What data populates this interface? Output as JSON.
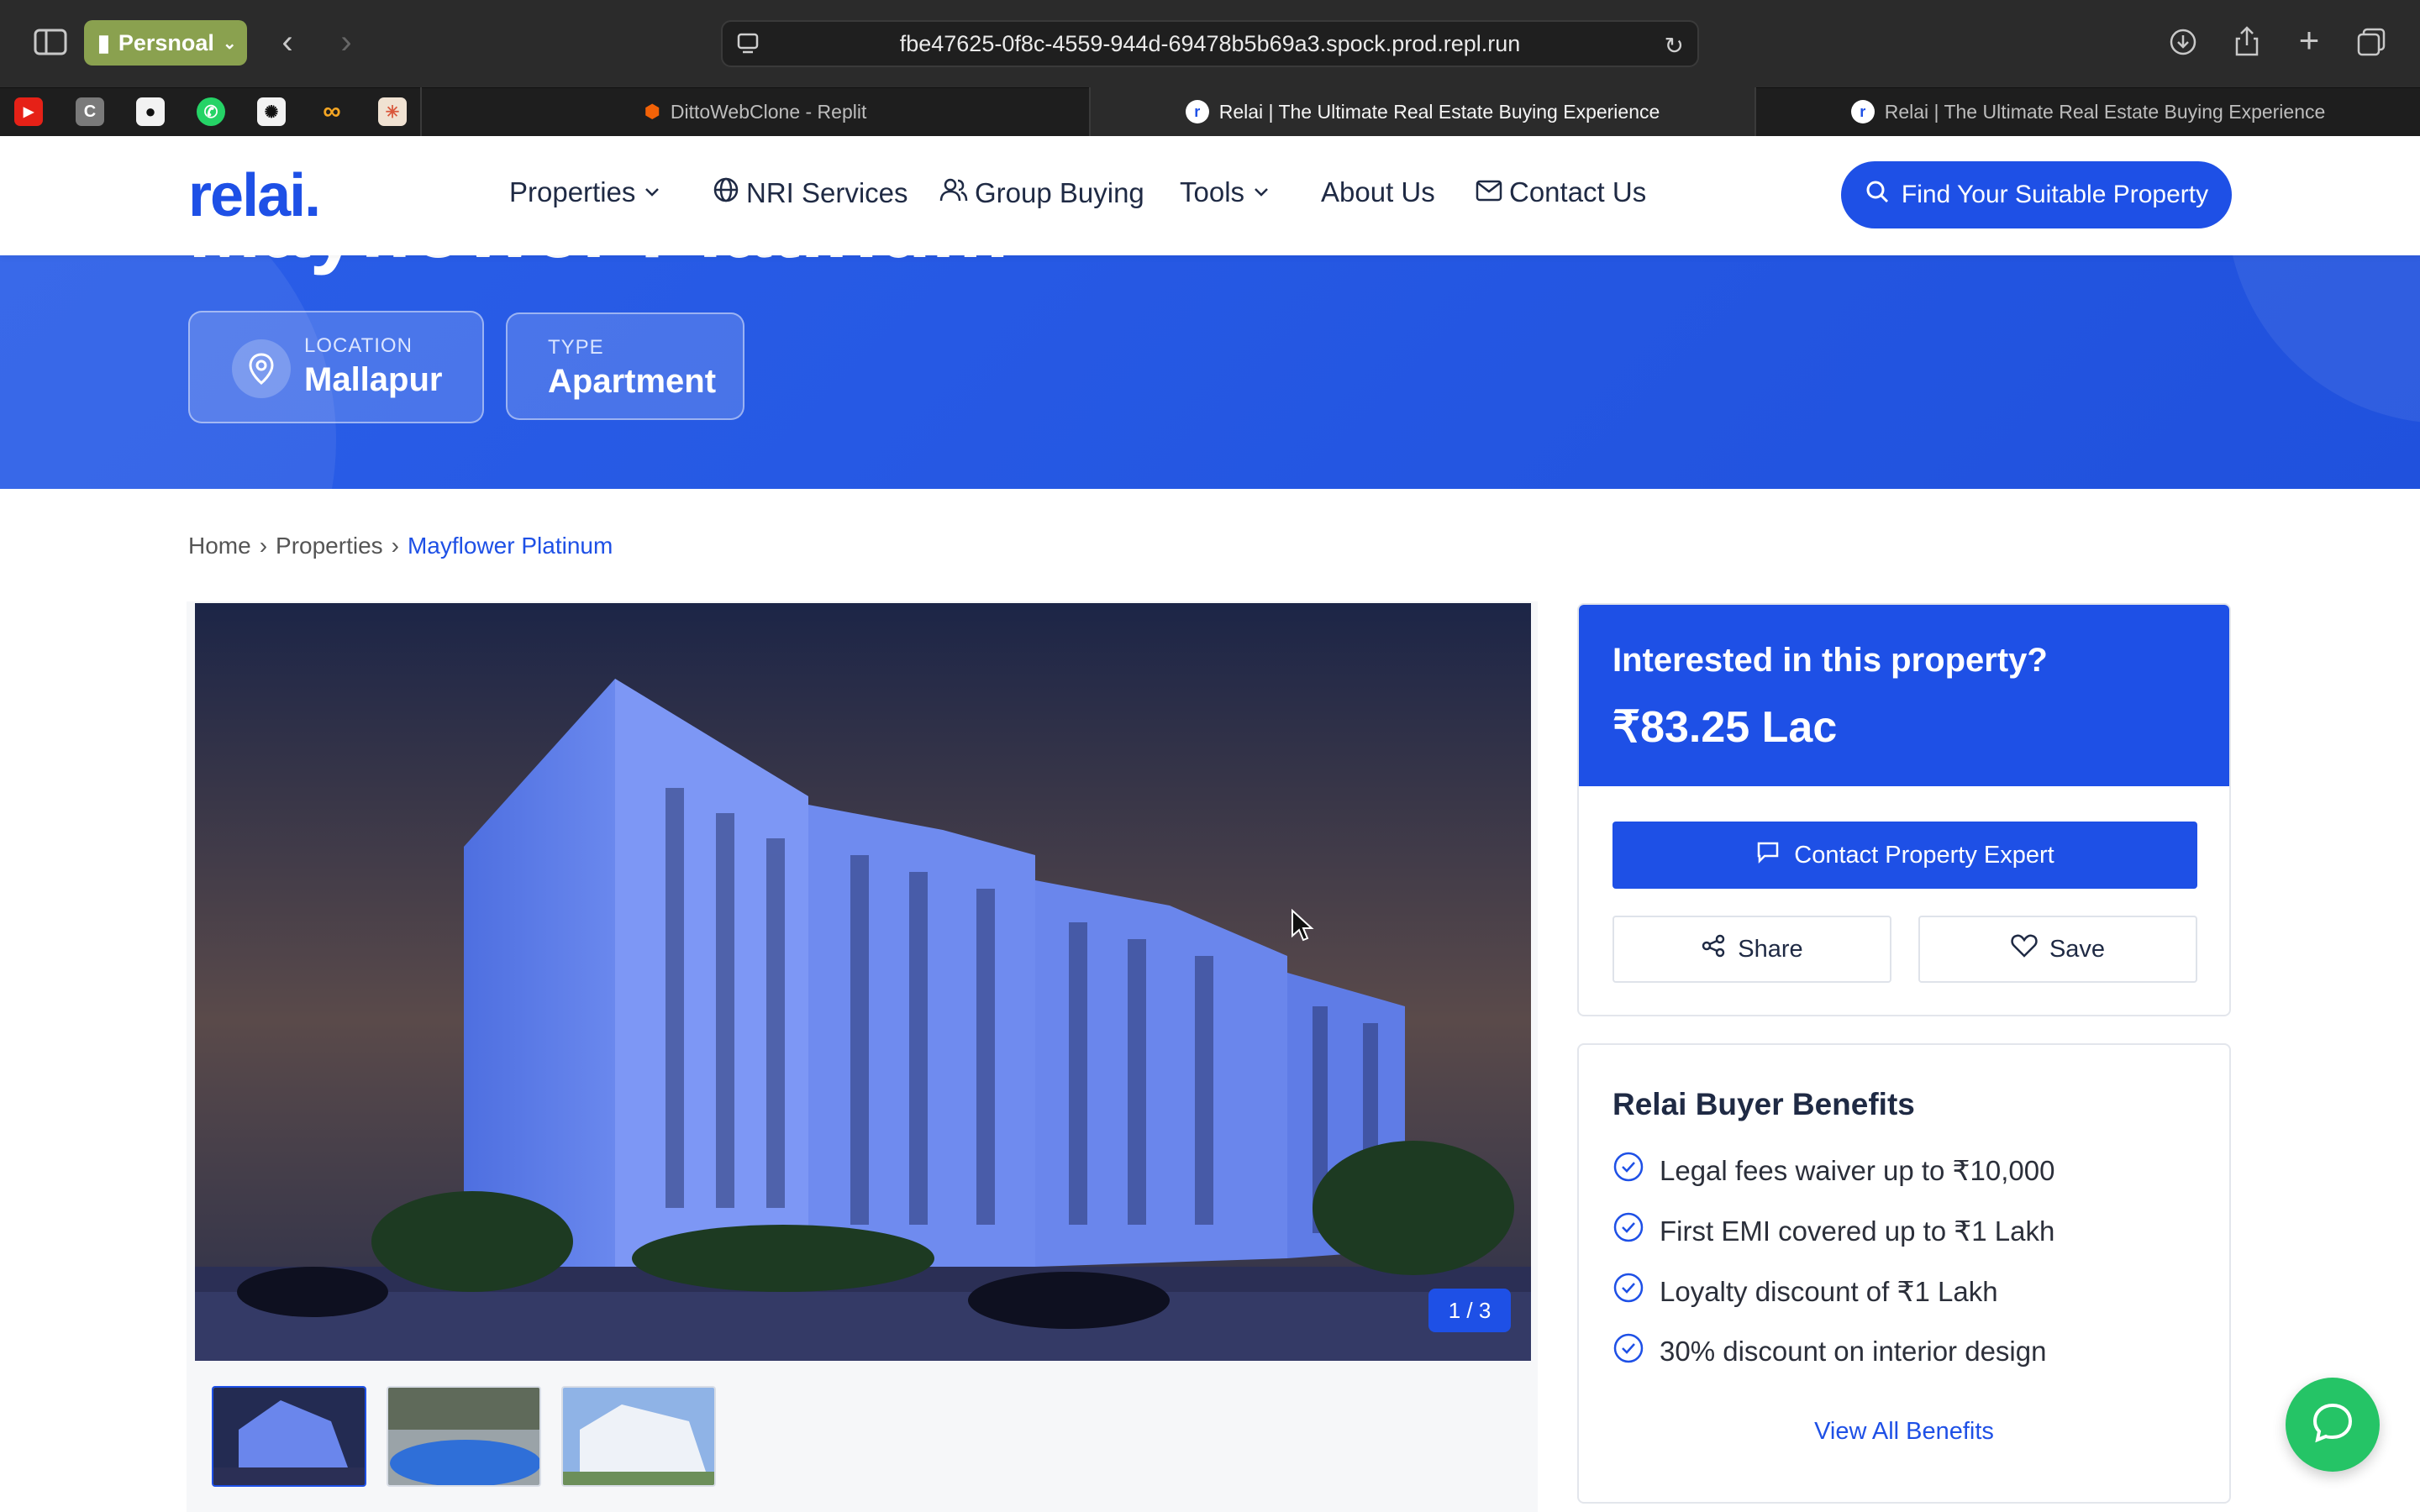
{
  "browser": {
    "profile_label": "Persnoal",
    "url": "fbe47625-0f8c-4559-944d-69478b5b69a3.spock.prod.repl.run",
    "favorites": [
      "youtube-icon",
      "c-icon",
      "github-icon",
      "whatsapp-icon",
      "openai-icon",
      "infinity-icon",
      "asterisk-icon"
    ],
    "tabs": [
      {
        "title": "DittoWebClone - Replit",
        "active": false
      },
      {
        "title": "Relai | The Ultimate Real Estate Buying Experience",
        "active": true
      },
      {
        "title": "Relai | The Ultimate Real Estate Buying Experience",
        "active": false
      }
    ]
  },
  "header": {
    "logo": "relai.",
    "nav": {
      "properties": "Properties",
      "nri": "NRI Services",
      "group": "Group Buying",
      "tools": "Tools",
      "about": "About Us",
      "contact": "Contact Us"
    },
    "cta": "Find Your Suitable Property"
  },
  "hero": {
    "title": "Mayflower Platinum",
    "location_label": "LOCATION",
    "location_value": "Mallapur",
    "type_label": "TYPE",
    "type_value": "Apartment"
  },
  "breadcrumb": {
    "home": "Home",
    "sep": "›",
    "properties": "Properties",
    "current": "Mayflower Platinum"
  },
  "gallery": {
    "counter": "1 / 3",
    "thumbnail_count": 3
  },
  "sidebar": {
    "heading": "Interested in this property?",
    "price": "₹83.25 Lac",
    "contact_label": "Contact Property Expert",
    "share_label": "Share",
    "save_label": "Save"
  },
  "benefits": {
    "title": "Relai Buyer Benefits",
    "items": [
      "Legal fees waiver up to ₹10,000",
      "First EMI covered up to ₹1 Lakh",
      "Loyalty discount of ₹1 Lakh",
      "30% discount on interior design"
    ],
    "view_all": "View All Benefits"
  },
  "colors": {
    "brand_blue": "#1e50e6",
    "chat_green": "#25c466"
  }
}
